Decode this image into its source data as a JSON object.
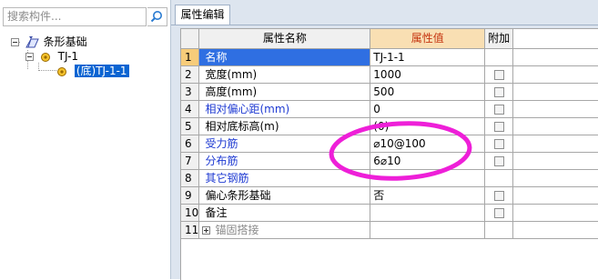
{
  "search": {
    "placeholder": "搜索构件..."
  },
  "tree": {
    "root": {
      "label": "条形基础"
    },
    "child": {
      "label": "TJ-1"
    },
    "leaf": {
      "label": "(底)TJ-1-1"
    }
  },
  "panel": {
    "tab_label": "属性编辑"
  },
  "table": {
    "headers": {
      "name": "属性名称",
      "value": "属性值",
      "extra": "附加"
    },
    "rows": [
      {
        "num": "1",
        "name": "名称",
        "value": "TJ-1-1",
        "checkbox": false
      },
      {
        "num": "2",
        "name": "宽度(mm)",
        "value": "1000",
        "checkbox": true
      },
      {
        "num": "3",
        "name": "高度(mm)",
        "value": "500",
        "checkbox": true
      },
      {
        "num": "4",
        "name": "相对偏心距(mm)",
        "value": "0",
        "checkbox": true
      },
      {
        "num": "5",
        "name": "相对底标高(m)",
        "value": "(0)",
        "checkbox": true
      },
      {
        "num": "6",
        "name": "受力筋",
        "value": "⌀10@100",
        "checkbox": true
      },
      {
        "num": "7",
        "name": "分布筋",
        "value": "6⌀10",
        "checkbox": true
      },
      {
        "num": "8",
        "name": "其它钢筋",
        "value": "",
        "checkbox": false
      },
      {
        "num": "9",
        "name": "偏心条形基础",
        "value": "否",
        "checkbox": true
      },
      {
        "num": "10",
        "name": "备注",
        "value": "",
        "checkbox": true
      },
      {
        "num": "11",
        "name": "锚固搭接",
        "value": "",
        "checkbox": false
      }
    ]
  },
  "colors": {
    "selection": "#2f6fe2",
    "value_header_bg": "#f9dfb3",
    "blue_text": "#1e3ad2",
    "annotation": "#ee1fd8"
  }
}
